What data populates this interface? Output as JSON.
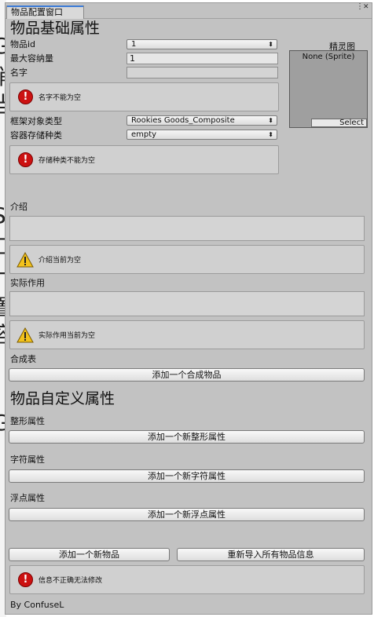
{
  "window": {
    "tab_title": "物品配置窗口",
    "menu_icon": "kebab-icon",
    "close_icon": "x"
  },
  "basic": {
    "heading": "物品基础属性",
    "id_label": "物品id",
    "id_value": "1",
    "capacity_label": "最大容纳量",
    "capacity_value": "1",
    "name_label": "名字",
    "name_value": "",
    "name_error": "名字不能为空",
    "frame_label": "框架对象类型",
    "frame_value": "Rookies Goods_Composite",
    "storage_label": "容器存储种类",
    "storage_value": "empty",
    "storage_error": "存储种类不能为空"
  },
  "sprite": {
    "label": "精灵图",
    "value": "None (Sprite)",
    "select_label": "Select"
  },
  "intro": {
    "label": "介绍",
    "warning": "介绍当前为空"
  },
  "effect": {
    "label": "实际作用",
    "warning": "实际作用当前为空"
  },
  "recipe": {
    "label": "合成表",
    "add_button": "添加一个合成物品"
  },
  "custom": {
    "heading": "物品自定义属性",
    "int_label": "整形属性",
    "int_button": "添加一个新整形属性",
    "str_label": "字符属性",
    "str_button": "添加一个新字符属性",
    "float_label": "浮点属性",
    "float_button": "添加一个新浮点属性"
  },
  "footer": {
    "add_item_button": "添加一个新物品",
    "reimport_button": "重新导入所有物品信息",
    "error": "信息不正确无法修改",
    "credit": "By ConfuseL"
  },
  "colors": {
    "error": "#cc1111",
    "warning": "#f2c21c",
    "tab_accent": "#3c7bd6"
  }
}
